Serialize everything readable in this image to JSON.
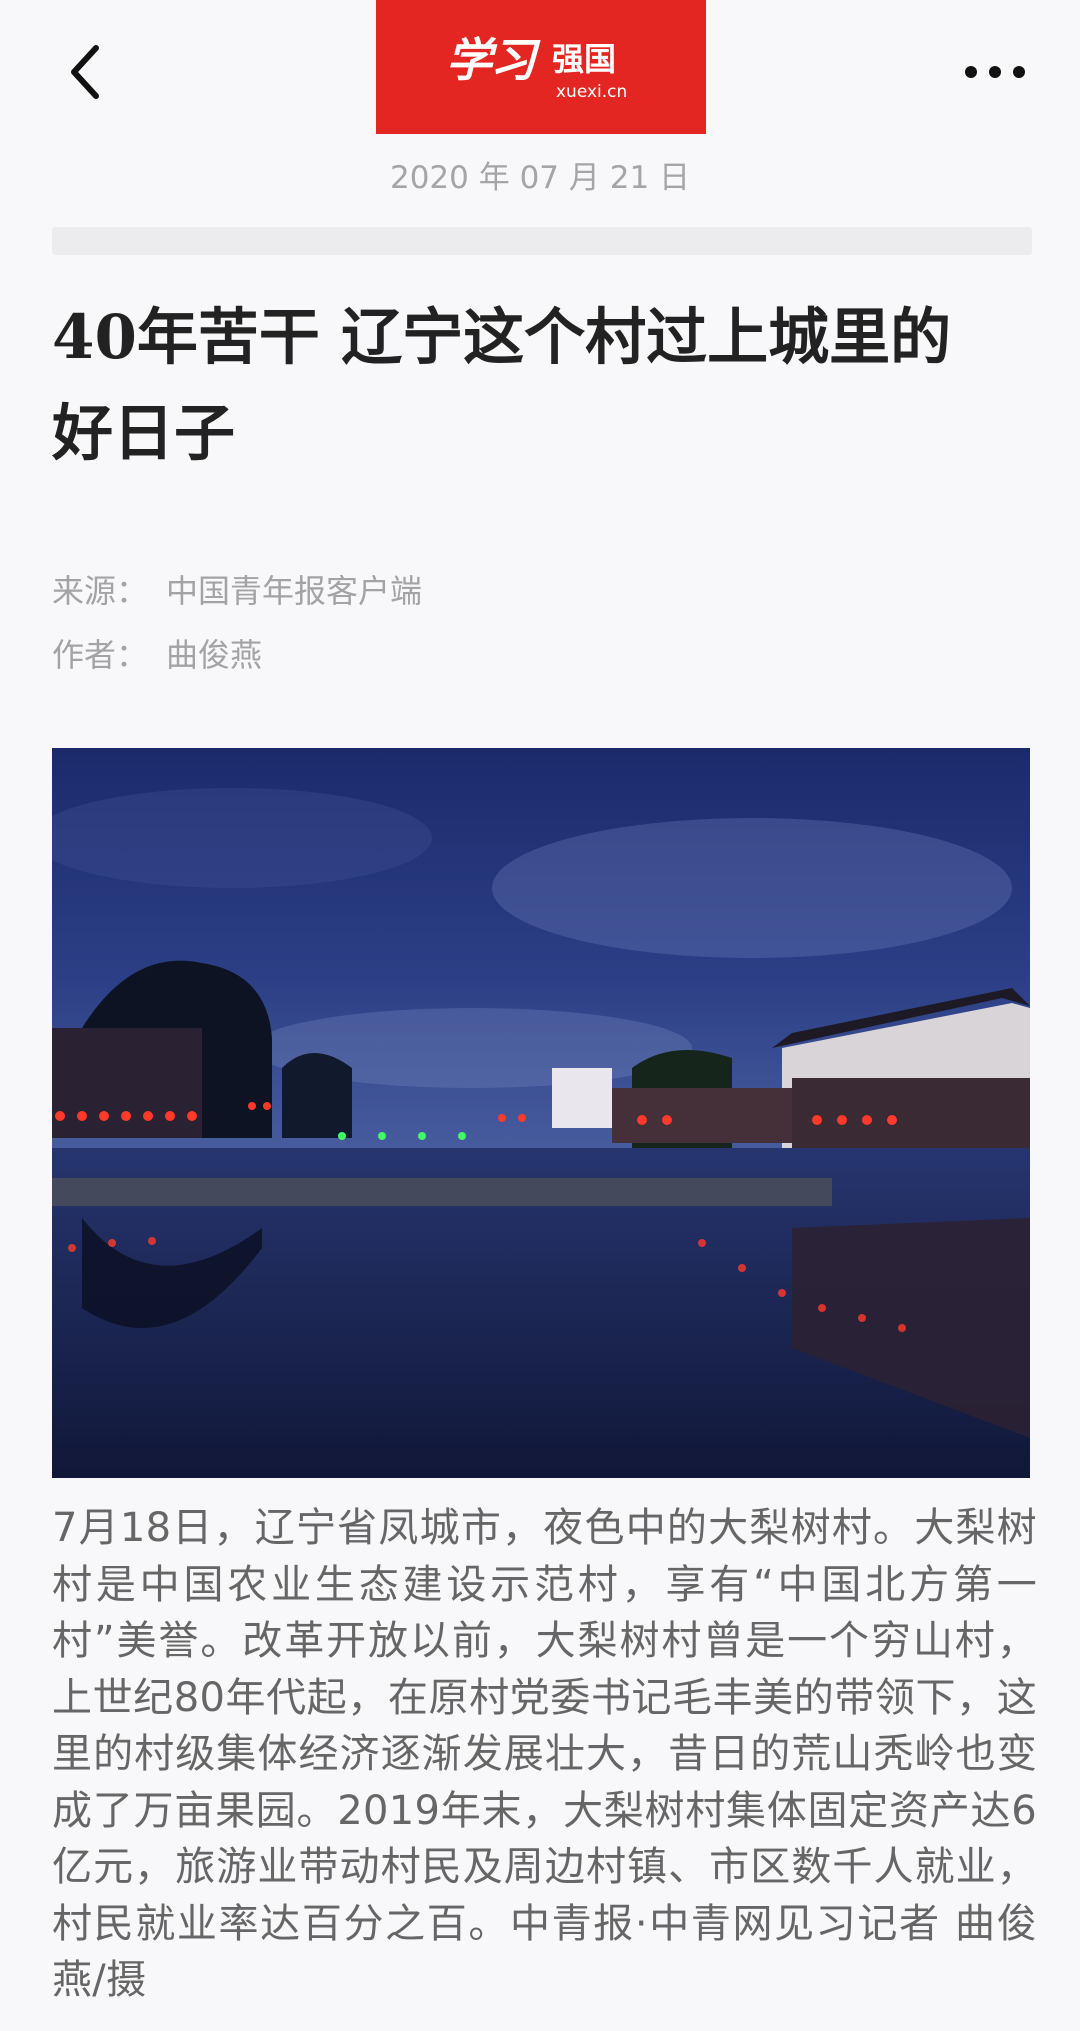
{
  "header": {
    "logo_script": "学习",
    "logo_brand": "强国",
    "logo_domain": "xuexi.cn",
    "back_icon": "chevron-left-icon",
    "more_icon": "more-horizontal-icon"
  },
  "article": {
    "date": "2020 年 07 月 21 日",
    "title": "40年苦干 辽宁这个村过上城里的好日子",
    "source_label": "来源：",
    "source_value": "中国青年报客户端",
    "author_label": "作者：",
    "author_value": "曲俊燕",
    "caption": "7月18日，辽宁省凤城市，夜色中的大梨树村。大梨树村是中国农业生态建设示范村，享有“中国北方第一村”美誉。改革开放以前，大梨树村曾是一个穷山村，上世纪80年代起，在原村党委书记毛丰美的带领下，这里的村级集体经济逐渐发展壮大，昔日的荒山秃岭也变成了万亩果园。2019年末，大梨树村集体固定资产达6亿元，旅游业带动村民及周边村镇、市区数千人就业，村民就业率达百分之百。中青报·中青网见习记者 曲俊燕/摄"
  },
  "colors": {
    "logo_red": "#e32622",
    "background": "#f8f8fa",
    "title_text": "#222222",
    "meta_text": "#a3a3a7",
    "body_text": "#666666"
  }
}
